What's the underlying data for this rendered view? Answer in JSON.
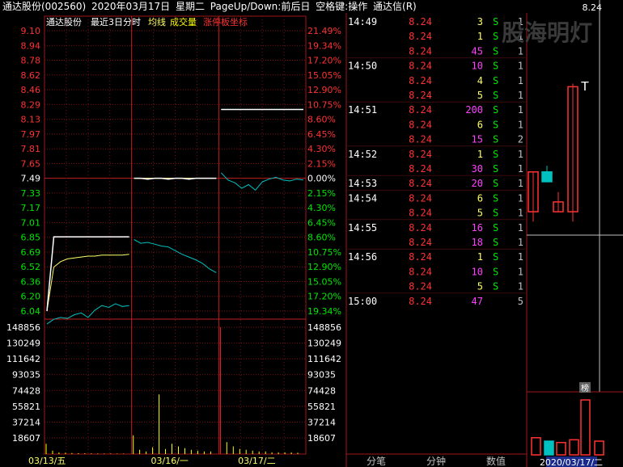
{
  "title_bar": {
    "stock": "通达股份(002560)",
    "date": "2020年03月17日",
    "weekday": "星期二",
    "hint": "PageUp/Down:前后日",
    "space_hint": "空格键:操作",
    "app": "通达信(R)"
  },
  "panel_header": {
    "name": "通达股份",
    "mode": "最近3日分时",
    "avg_legend": "均线",
    "vol_legend": "成交量",
    "limit_legend": "涨停板坐标"
  },
  "watermark": "股海明灯",
  "colors": {
    "up": "#ff3232",
    "down": "#00e600",
    "price_line": "#ffffff",
    "avg_line": "#ffff66",
    "cross_section": "#00c0c0",
    "volume": "#ffff00",
    "grid": "#801010",
    "magenta": "#ff40ff"
  },
  "chart_data": [
    {
      "type": "line",
      "title": "最近3日分时",
      "y_price_ticks": [
        "9.10",
        "8.94",
        "8.78",
        "8.62",
        "8.46",
        "8.29",
        "8.13",
        "7.97",
        "7.81",
        "7.65",
        "7.49",
        "7.33",
        "7.17",
        "7.01",
        "6.85",
        "6.69",
        "6.52",
        "6.36",
        "6.20",
        "6.04"
      ],
      "y_pct_ticks": [
        "21.49%",
        "19.34%",
        "17.20%",
        "15.05%",
        "12.90%",
        "10.75%",
        "8.60%",
        "6.45%",
        "4.30%",
        "2.15%",
        "0.00%",
        "2.15%",
        "4.30%",
        "6.45%",
        "8.60%",
        "10.75%",
        "12.90%",
        "15.05%",
        "17.20%",
        "19.34%"
      ],
      "ylim": [
        6.04,
        9.1
      ],
      "days": [
        "03/13/五",
        "03/16/一",
        "03/17/二"
      ],
      "series": [
        {
          "day": "03/13/五",
          "price": [
            6.04,
            6.85,
            6.85,
            6.85,
            6.85,
            6.85,
            6.85,
            6.85,
            6.85,
            6.85,
            6.85,
            6.85,
            6.85
          ],
          "avg": [
            6.04,
            6.52,
            6.58,
            6.61,
            6.62,
            6.63,
            6.64,
            6.64,
            6.65,
            6.65,
            6.65,
            6.65,
            6.66
          ],
          "cross": [
            5.9,
            5.95,
            5.97,
            5.96,
            6.0,
            6.02,
            5.97,
            6.05,
            6.1,
            6.08,
            6.12,
            6.09,
            6.1
          ]
        },
        {
          "day": "03/16/一",
          "price": [
            7.49,
            7.49,
            7.48,
            7.49,
            7.49,
            7.48,
            7.49,
            7.49,
            7.48,
            7.49,
            7.49,
            7.49,
            7.49
          ],
          "avg": [
            7.49,
            7.49,
            7.49,
            7.49,
            7.49,
            7.49,
            7.49,
            7.49,
            7.49,
            7.49,
            7.49,
            7.49,
            7.49
          ],
          "cross": [
            6.82,
            6.78,
            6.79,
            6.77,
            6.75,
            6.74,
            6.7,
            6.66,
            6.63,
            6.6,
            6.56,
            6.5,
            6.46
          ]
        },
        {
          "day": "03/17/二",
          "price": [
            8.24,
            8.24,
            8.24,
            8.24,
            8.24,
            8.24,
            8.24,
            8.24,
            8.24,
            8.24,
            8.24,
            8.24,
            8.24
          ],
          "avg": [
            8.24,
            8.24,
            8.24,
            8.24,
            8.24,
            8.24,
            8.24,
            8.24,
            8.24,
            8.24,
            8.24,
            8.24,
            8.24
          ],
          "cross": [
            7.55,
            7.47,
            7.44,
            7.38,
            7.42,
            7.36,
            7.45,
            7.48,
            7.5,
            7.47,
            7.46,
            7.48,
            7.47
          ]
        }
      ]
    },
    {
      "type": "bar",
      "title": "成交量",
      "y_ticks": [
        "148856",
        "130249",
        "111642",
        "93035",
        "74428",
        "55821",
        "37214",
        "18607"
      ],
      "ylim": [
        0,
        148856
      ],
      "peaks": [
        {
          "day": "03/13/五",
          "values": [
            12000,
            4000,
            2000,
            1500,
            1200,
            1000,
            900,
            800,
            700,
            600,
            600,
            500,
            500
          ]
        },
        {
          "day": "03/16/一",
          "values": [
            22000,
            5000,
            3000,
            8000,
            70000,
            6000,
            12000,
            9000,
            7000,
            5000,
            4000,
            3000,
            3000
          ]
        },
        {
          "day": "03/17/二",
          "values": [
            148856,
            14000,
            9000,
            6000,
            5000,
            4000,
            3000,
            3000,
            2000,
            2000,
            2000,
            2000,
            1500
          ]
        }
      ]
    }
  ],
  "trades": [
    {
      "time": "14:49",
      "price": "8.24",
      "vol": "3",
      "bs": "S",
      "n": "1"
    },
    {
      "time": "",
      "price": "8.24",
      "vol": "1",
      "bs": "S",
      "n": "1"
    },
    {
      "time": "",
      "price": "8.24",
      "vol": "45",
      "bs": "S",
      "n": "1"
    },
    {
      "time": "14:50",
      "price": "8.24",
      "vol": "10",
      "bs": "S",
      "n": "1"
    },
    {
      "time": "",
      "price": "8.24",
      "vol": "4",
      "bs": "S",
      "n": "1"
    },
    {
      "time": "",
      "price": "8.24",
      "vol": "5",
      "bs": "S",
      "n": "1"
    },
    {
      "time": "14:51",
      "price": "8.24",
      "vol": "200",
      "bs": "S",
      "n": "1"
    },
    {
      "time": "",
      "price": "8.24",
      "vol": "6",
      "bs": "S",
      "n": "1"
    },
    {
      "time": "",
      "price": "8.24",
      "vol": "15",
      "bs": "S",
      "n": "2"
    },
    {
      "time": "14:52",
      "price": "8.24",
      "vol": "1",
      "bs": "S",
      "n": "1"
    },
    {
      "time": "",
      "price": "8.24",
      "vol": "30",
      "bs": "S",
      "n": "1"
    },
    {
      "time": "14:53",
      "price": "8.24",
      "vol": "20",
      "bs": "S",
      "n": "1"
    },
    {
      "time": "14:54",
      "price": "8.24",
      "vol": "6",
      "bs": "S",
      "n": "1"
    },
    {
      "time": "",
      "price": "8.24",
      "vol": "5",
      "bs": "S",
      "n": "1"
    },
    {
      "time": "14:55",
      "price": "8.24",
      "vol": "16",
      "bs": "S",
      "n": "1"
    },
    {
      "time": "",
      "price": "8.24",
      "vol": "18",
      "bs": "S",
      "n": "1"
    },
    {
      "time": "14:56",
      "price": "8.24",
      "vol": "1",
      "bs": "S",
      "n": "1"
    },
    {
      "time": "",
      "price": "8.24",
      "vol": "10",
      "bs": "S",
      "n": "1"
    },
    {
      "time": "",
      "price": "8.24",
      "vol": "5",
      "bs": "S",
      "n": "1"
    },
    {
      "time": "15:00",
      "price": "8.24",
      "vol": "47",
      "bs": "",
      "n": "5"
    }
  ],
  "mini_kline": {
    "price_label": "8.24",
    "bang_label": "榜",
    "date_label": "2020/03/17/二",
    "candles": [
      {
        "open": 6.85,
        "close": 6.2,
        "high": 6.85,
        "low": 6.04,
        "up": true
      },
      {
        "open": 6.69,
        "close": 6.85,
        "high": 6.95,
        "low": 6.69,
        "up": false
      },
      {
        "open": 6.36,
        "close": 6.2,
        "high": 6.52,
        "low": 6.2,
        "up": true
      },
      {
        "open": 8.24,
        "close": 6.2,
        "high": 8.29,
        "low": 6.04,
        "up": true
      }
    ],
    "vols": [
      25000,
      20000,
      18000,
      22000,
      80000,
      20000
    ]
  },
  "bottom_tabs": [
    "分笔",
    "分钟",
    "数值"
  ]
}
